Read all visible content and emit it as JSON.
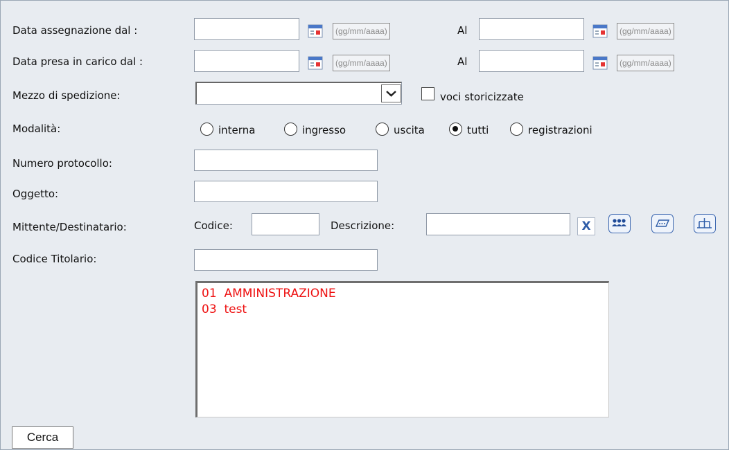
{
  "form": {
    "data_assegnazione_label": "Data assegnazione dal :",
    "data_presa_label": "Data presa in carico dal :",
    "al_label": "Al",
    "date_format_hint": "(gg/mm/aaaa)",
    "mezzo_label": "Mezzo di spedizione:",
    "mezzo_value": "",
    "voci_storicizzate_label": "voci storicizzate",
    "modalita_label": "Modalità:",
    "modalita_options": [
      "interna",
      "ingresso",
      "uscita",
      "tutti",
      "registrazioni"
    ],
    "modalita_selected": "tutti",
    "numero_protocollo_label": "Numero protocollo:",
    "oggetto_label": "Oggetto:",
    "mittente_label": "Mittente/Destinatario:",
    "codice_label": "Codice:",
    "descrizione_label": "Descrizione:",
    "codice_titolario_label": "Codice Titolario:",
    "clear_button_label": "X",
    "titolario_items": [
      "01  AMMINISTRAZIONE",
      "03  test"
    ],
    "cerca_label": "Cerca"
  },
  "icons": {
    "calendar": "calendar-icon",
    "clear": "clear-icon",
    "rubrica": "people-icon",
    "lista": "list-icon",
    "organigramma": "org-chart-icon"
  },
  "colors": {
    "list_text": "#ee1111",
    "icon_blue": "#2f5da8",
    "panel_bg": "#e8ecf1"
  }
}
